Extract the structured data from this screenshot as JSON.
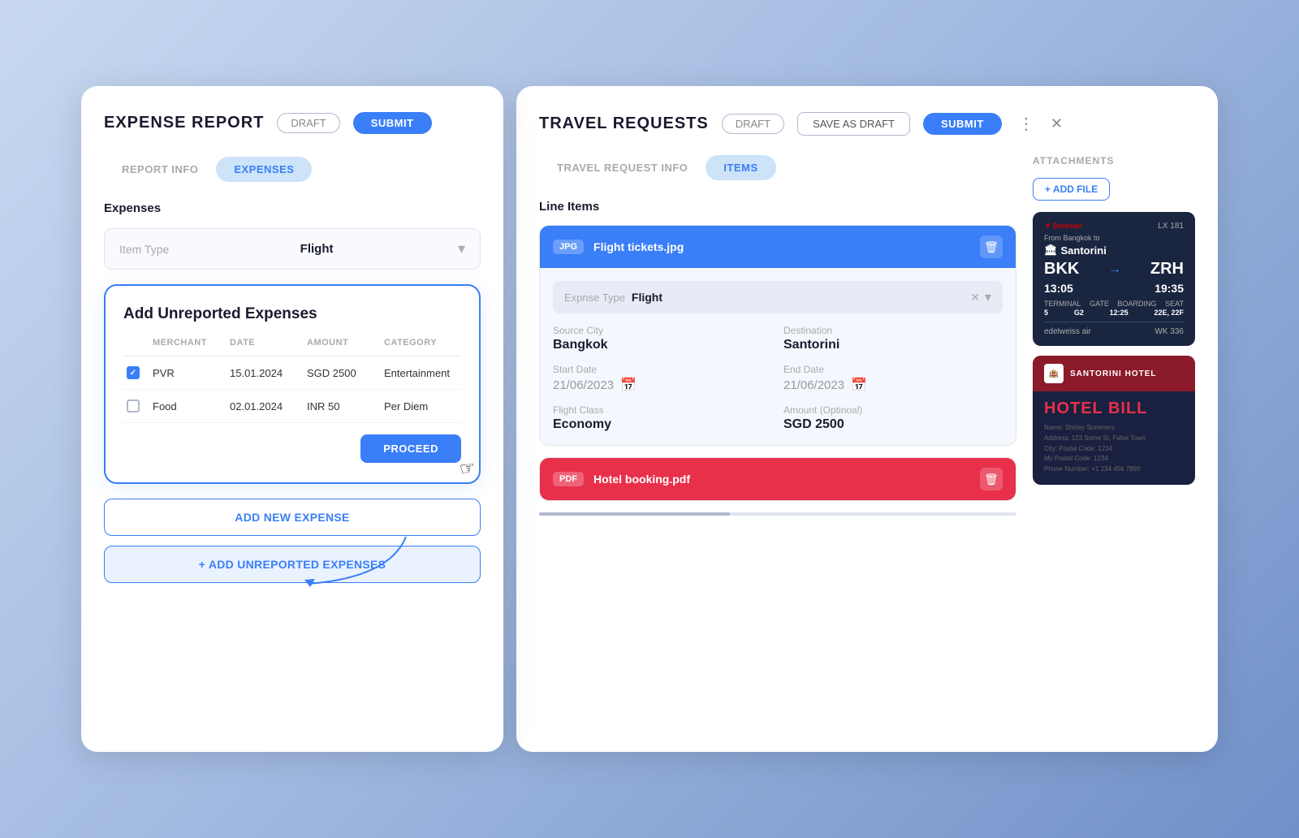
{
  "leftPanel": {
    "title": "EXPENSE REPORT",
    "draftLabel": "DRAFT",
    "submitLabel": "SUBMIT",
    "tabs": [
      {
        "label": "REPORT INFO",
        "active": false
      },
      {
        "label": "EXPENSES",
        "active": true
      }
    ],
    "sectionLabel": "Expenses",
    "itemTypeLabel": "Item Type",
    "itemTypeValue": "Flight",
    "unreportedModal": {
      "title": "Add Unreported Expenses",
      "columns": [
        "MERCHANT",
        "DATE",
        "AMOUNT",
        "CATEGORY"
      ],
      "rows": [
        {
          "checked": true,
          "merchant": "PVR",
          "date": "15.01.2024",
          "amount": "SGD 2500",
          "category": "Entertainment"
        },
        {
          "checked": false,
          "merchant": "Food",
          "date": "02.01.2024",
          "amount": "INR 50",
          "category": "Per Diem"
        }
      ],
      "proceedLabel": "PROCEED"
    },
    "addNewLabel": "ADD NEW EXPENSE",
    "addUnreportedLabel": "+ ADD UNREPORTED EXPENSES"
  },
  "rightPanel": {
    "title": "TRAVEL REQUESTS",
    "draftLabel": "DRAFT",
    "saveAsDraftLabel": "SAVE AS DRAFT",
    "submitLabel": "SUBMIT",
    "tabs": [
      {
        "label": "TRAVEL REQUEST INFO",
        "active": false
      },
      {
        "label": "ITEMS",
        "active": true
      }
    ],
    "lineItemsTitle": "Line Items",
    "lineItems": [
      {
        "type": "JPG",
        "color": "blue",
        "fileName": "Flight tickets.jpg",
        "expenseTypeLabel": "Expnse Type",
        "expenseTypeValue": "Flight",
        "fields": [
          {
            "label": "Source City",
            "value": "Bangkok"
          },
          {
            "label": "Destination",
            "value": "Santorini"
          },
          {
            "label": "Start Date",
            "value": "21/06/2023",
            "hasIcon": true
          },
          {
            "label": "End Date",
            "value": "21/06/2023",
            "hasIcon": true
          },
          {
            "label": "Flight Class",
            "value": "Economy"
          },
          {
            "label": "Amount (Optinoal)",
            "value": "SGD 2500"
          }
        ]
      },
      {
        "type": "PDF",
        "color": "red",
        "fileName": "Hotel booking.pdf"
      }
    ],
    "attachments": {
      "title": "ATTACHMENTS",
      "addFileLabel": "+ ADD FILE",
      "flightTicket": {
        "airline1": "Swissair",
        "flightNum1": "LX 181",
        "from": "BKK",
        "to": "ZRH",
        "depTime": "13:05",
        "arrTime": "19:35",
        "terminal": "5",
        "gate": "G2",
        "boardingTime": "12:25",
        "seat": "22E, 22F",
        "airline2": "edelweiss air",
        "flightNum2": "WK 336"
      },
      "hotelBill": {
        "hotelName": "SANTORINI HOTEL",
        "billTitle": "HOTEL BILL",
        "lines": [
          "Name: Shirley Summers",
          "Address: 123 Some St, False Town",
          "City: Postal Code: 1234",
          "My Postal Code: 1234",
          "Phone Number: +1 234 456 7890"
        ]
      }
    }
  }
}
